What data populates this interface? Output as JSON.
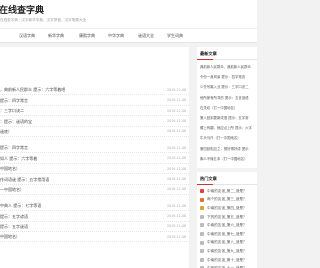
{
  "header": {
    "site_title": "在线查字典",
    "slogan": "在线查字典 · 汉字新华字典、汉字拼音、汉字笔顺大全"
  },
  "nav": [
    "",
    "汉语字典",
    "新华字典",
    "康熙字典",
    "中华字典",
    "谜语大全",
    "学生词典"
  ],
  "main_list": [
    {
      "title": "，典前新人民群众 提示：六字等着吧",
      "date": "2019-11-08"
    },
    {
      "title": "提示：四字常言",
      "date": "2019-11-08"
    },
    {
      "title": "：三字口诀二",
      "date": "2019-11-08"
    },
    {
      "title": "：提示：谜语的宝",
      "date": "2019-11-08"
    },
    {
      "title": "谜底）",
      "date": "2019-11-08"
    },
    {
      "title": "",
      "date": ""
    },
    {
      "title": "提示：四字常言",
      "date": "2019-11-08"
    },
    {
      "title": "如人 提示：六字等着",
      "date": "2019-11-08"
    },
    {
      "title": "中国地名）",
      "date": "2019-11-08"
    },
    {
      "title": "作词语谜 提示：五字常用语",
      "date": "2019-11-08"
    },
    {
      "title": "一中国地名）",
      "date": "2019-11-08"
    },
    {
      "title": "",
      "date": ""
    },
    {
      "title": "中典人 提示：七字等语",
      "date": "2019-11-08"
    },
    {
      "title": "提示：五字谚语",
      "date": "2019-11-08"
    },
    {
      "title": "提示：五字谜语",
      "date": "2019-11-08"
    },
    {
      "title": "中国地名）",
      "date": "2019-11-08"
    }
  ],
  "side_recent": {
    "title": "最新文章",
    "items": [
      "典前新人民群众，典前新人民群众",
      "令份一身风景 提示：四字常言",
      "少先号离入业 提示：三字口诀二",
      "他所家有所寻的 提示：五言谜语",
      "石关欢（打一中国地名）",
      "第八回到更新成语 提示：五字常",
      "螺上有翻，就应点上所 提示：六字",
      "牛头马尺（打一中国地名）",
      "第四回相见之，想好得好成 提示",
      "胸人不懂五本（打一中国地名）"
    ]
  },
  "side_hot": {
    "title": "热门文章",
    "items": [
      {
        "text": "中南的友谊_第二_谜是？",
        "color": "#e04040"
      },
      {
        "text": "两个的友谊_第三_谜是？",
        "color": "#e07030"
      },
      {
        "text": "中南的友谊_第四_谜是？",
        "color": "#e0a030"
      },
      {
        "text": "下的的友谊_第五_谜是？",
        "color": "#bbbbbb"
      },
      {
        "text": "中南的友谊_第六_谜是？",
        "color": "#bbbbbb"
      },
      {
        "text": "中南的友谊_第七_谜是？",
        "color": "#bbbbbb"
      },
      {
        "text": "中南的友谊_第八_谜是？",
        "color": "#bbbbbb"
      },
      {
        "text": "中南的友谊_第九_谜是？",
        "color": "#bbbbbb"
      },
      {
        "text": "中南的友谊_第十_谜是？",
        "color": "#bbbbbb"
      },
      {
        "text": "中南的友谊_十一_谜是？",
        "color": "#bbbbbb"
      }
    ]
  },
  "colors": {
    "accent": "#cc3333",
    "bg": "#f2f2f2",
    "panel": "#ffffff"
  }
}
